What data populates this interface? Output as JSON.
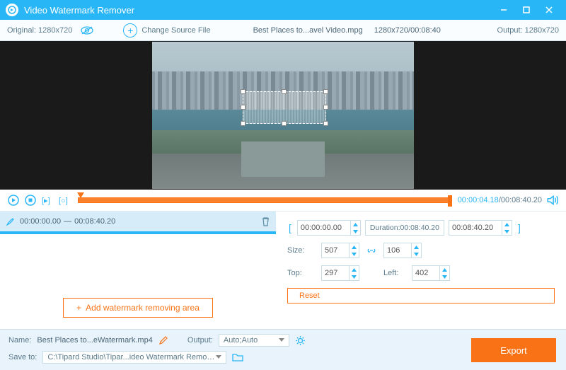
{
  "titlebar": {
    "title": "Video Watermark Remover"
  },
  "header": {
    "original_label": "Original:",
    "original_res": "1280x720",
    "change_source": "Change Source File",
    "filename": "Best Places to...avel Video.mpg",
    "file_res_time": "1280x720/00:08:40",
    "output_label": "Output:",
    "output_res": "1280x720"
  },
  "playback": {
    "current": "00:00:04.18",
    "total": "00:08:40.20"
  },
  "segment": {
    "start": "00:00:00.00",
    "sep": "—",
    "end": "00:08:40.20"
  },
  "controls": {
    "add_area": "Add watermark removing area",
    "time_start": "00:00:00.00",
    "duration_label": "Duration:",
    "duration_val": "00:08:40.20",
    "time_end": "00:08:40.20",
    "size_label": "Size:",
    "size_w": "507",
    "size_h": "106",
    "top_label": "Top:",
    "top_val": "297",
    "left_label": "Left:",
    "left_val": "402",
    "reset": "Reset"
  },
  "footer": {
    "name_label": "Name:",
    "name_val": "Best Places to...eWatermark.mp4",
    "output_label": "Output:",
    "output_val": "Auto;Auto",
    "save_label": "Save to:",
    "save_path": "C:\\Tipard Studio\\Tipar...ideo Watermark Remover",
    "export": "Export"
  }
}
